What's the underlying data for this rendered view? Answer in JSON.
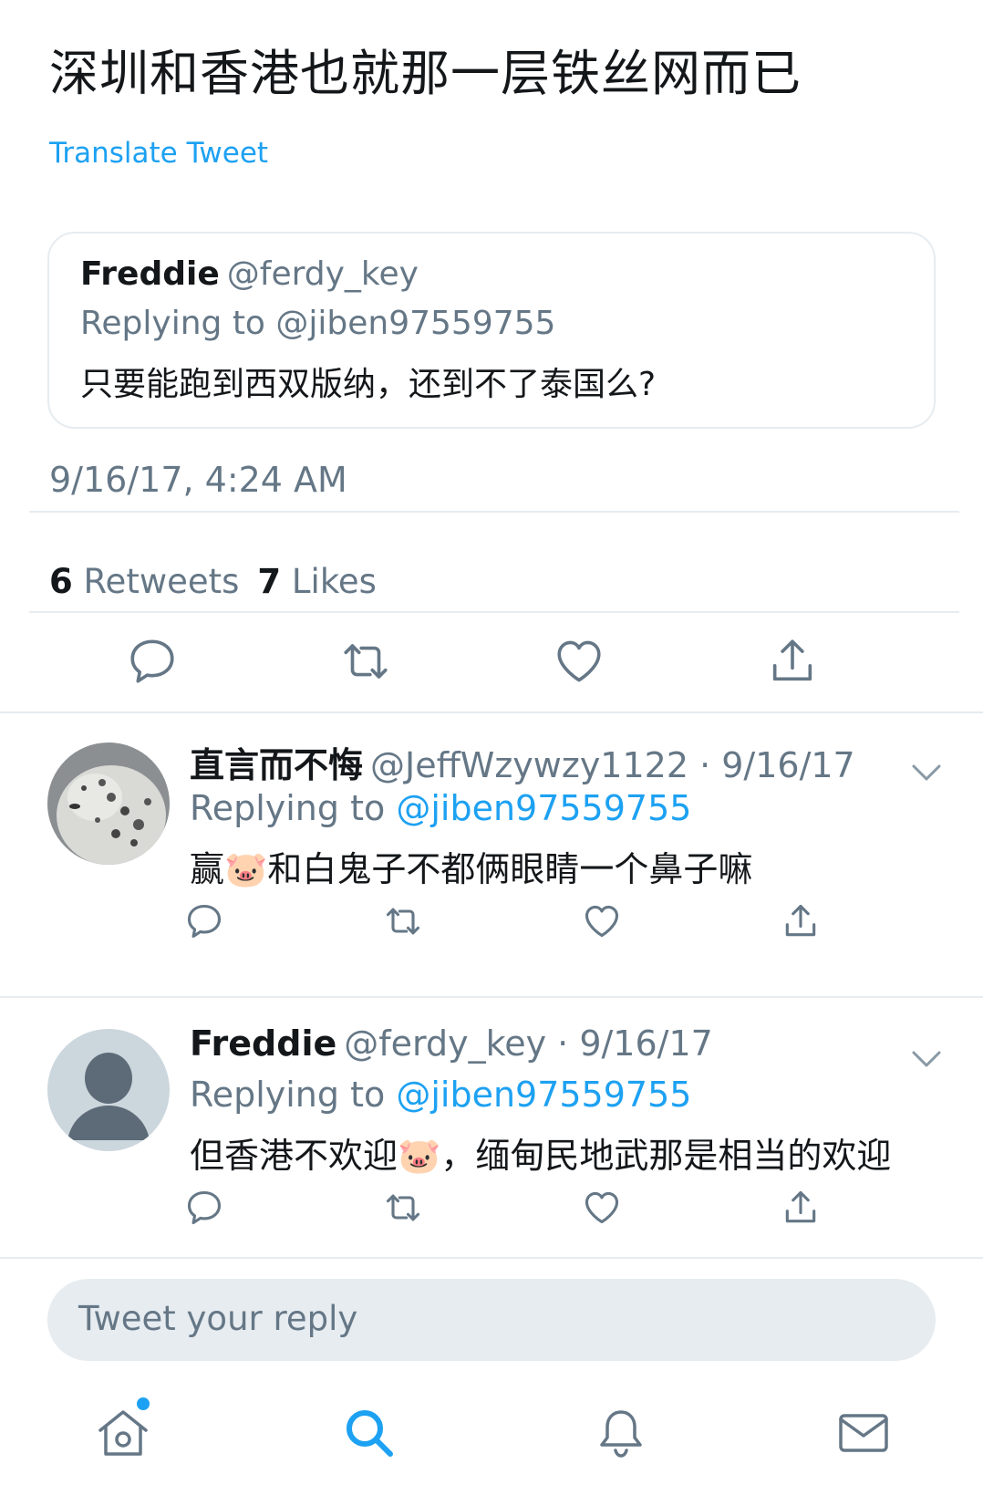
{
  "tweet": {
    "text": "深圳和香港也就那一层铁丝网而已",
    "translate_label": "Translate Tweet",
    "timestamp": "9/16/17, 4:24 AM",
    "retweets_count": "6",
    "retweets_label": "Retweets",
    "likes_count": "7",
    "likes_label": "Likes"
  },
  "quoted": {
    "name": "Freddie",
    "handle": "@ferdy_key",
    "replying": "Replying to @jiben97559755",
    "body": "只要能跑到西双版纳，还到不了泰国么?"
  },
  "replies": [
    {
      "name": "直言而不悔",
      "meta": "@JeffWzywzy1122 · 9/16/17",
      "replying_prefix": "Replying to",
      "mention": "@jiben97559755",
      "body": "赢🐷和白鬼子不都俩眼睛一个鼻子嘛",
      "avatar": "snow-leopard-avatar"
    },
    {
      "name": "Freddie",
      "meta": "@ferdy_key · 9/16/17",
      "replying_prefix": "Replying to",
      "mention": "@jiben97559755",
      "body": "但香港不欢迎🐷，缅甸民地武那是相当的欢迎",
      "avatar": "default-avatar"
    }
  ],
  "compose": {
    "placeholder": "Tweet your reply"
  },
  "icons": {
    "reply": "reply-icon",
    "retweet": "retweet-icon",
    "like": "heart-icon",
    "share": "share-icon",
    "home": "home-icon",
    "search": "search-icon",
    "notifications": "bell-icon",
    "messages": "mail-icon",
    "chevron": "chevron-down-icon"
  },
  "colors": {
    "accent": "#1da1f2",
    "text": "#14171a",
    "secondary": "#657786",
    "border": "#e6ecf0"
  }
}
